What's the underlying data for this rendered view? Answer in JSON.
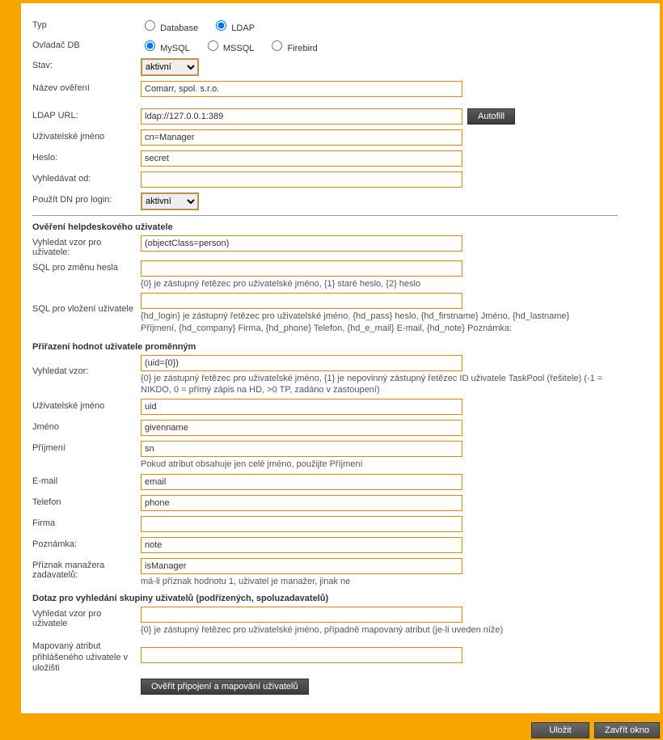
{
  "top": {
    "type_label": "Typ",
    "type_opts": {
      "database": "Database",
      "ldap": "LDAP"
    },
    "type_selected": "ldap",
    "driver_label": "Ovladač DB",
    "driver_opts": {
      "mysql": "MySQL",
      "mssql": "MSSQL",
      "firebird": "Firebird"
    },
    "driver_selected": "mysql",
    "state_label": "Stav:",
    "state_value": "aktivní",
    "name_label": "Název ověření",
    "name_value": "Comarr, spol. s.r.o.",
    "ldapurl_label": "LDAP URL:",
    "ldapurl_value": "ldap://127.0.0.1:389",
    "autofill_label": "Autofill",
    "user_label": "Uživatelské jméno",
    "user_value": "cn=Manager",
    "password_label": "Heslo:",
    "password_value": "secret",
    "searchfrom_label": "Vyhledávat od:",
    "searchfrom_value": "",
    "usedn_label": "Použít DN pro login:",
    "usedn_value": "aktivní"
  },
  "sec1": {
    "title": "Ověření helpdeskového uživatele",
    "search_label": "Vyhledat vzor pro uživatele:",
    "search_value": "(objectClass=person)",
    "pwchange_label": "SQL pro změnu hesla",
    "pwchange_value": "",
    "pwchange_hint": "{0} je zástupný řetězec pro uživatelské jméno, {1} staré heslo, {2} heslo",
    "insert_label": "SQL pro vložení uživatele",
    "insert_value": "",
    "insert_hint": "{hd_login} je zástupný řetězec pro uživatelské jméno, {hd_pass} heslo, {hd_firstname} Jméno, {hd_lastname} Příjmení, {hd_company} Firma, {hd_phone} Telefon, {hd_e_mail} E-mail, {hd_note} Poznámka:"
  },
  "sec2": {
    "title": "Přiřazení hodnot uživatele proměnným",
    "search_label": "Vyhledat vzor:",
    "search_value": "(uid={0})",
    "search_hint": "{0} je zástupný řetězec pro uživatelské jméno, {1} je nepovinný zástupný řetězec ID uživatele TaskPool (řešitele) (-1 = NIKDO, 0 = přímý zápis na HD, >0 TP, zadáno v zastoupení)",
    "user_label": "Uživatelské jméno",
    "user_value": "uid",
    "first_label": "Jméno",
    "first_value": "givenname",
    "last_label": "Příjmení",
    "last_value": "sn",
    "last_hint": "Pokud atribut obsahuje jen celé jméno, použijte Příjmení",
    "email_label": "E-mail",
    "email_value": "email",
    "phone_label": "Telefon",
    "phone_value": "phone",
    "company_label": "Firma",
    "company_value": "",
    "note_label": "Poznámka:",
    "note_value": "note",
    "manager_label": "Příznak manažera zadavatelů:",
    "manager_value": "isManager",
    "manager_hint": "má-li příznak hodnotu 1, uživatel je manažer, jinak ne"
  },
  "sec3": {
    "title": "Dotaz pro vyhledání skupiny uživatelů (podřízených, spoluzadavatelů)",
    "search_label": "Vyhledat vzor pro uživatele",
    "search_value": "",
    "search_hint": "{0} je zástupný řetězec pro uživatelské jméno, případně mapovaný atribut (je-li uveden níže)",
    "mapattr_label": "Mapovaný atribut přihlášeného uživatele v uložišti",
    "mapattr_value": "",
    "verify_btn": "Ověřit připojení a mapování uživatelů"
  },
  "footer": {
    "save": "Uložit",
    "close": "Zavřít okno"
  }
}
